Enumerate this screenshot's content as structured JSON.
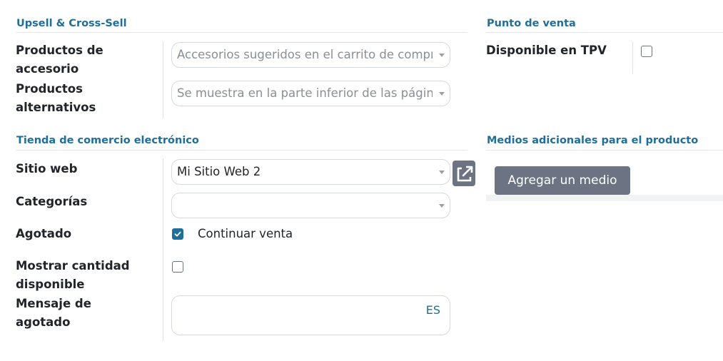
{
  "sections": {
    "upsell": {
      "title": "Upsell & Cross-Sell"
    },
    "pos": {
      "title": "Punto de venta"
    },
    "ecommerce": {
      "title": "Tienda de comercio electrónico"
    },
    "media": {
      "title": "Medios adicionales para el producto"
    }
  },
  "upsell": {
    "accessory": {
      "label_line1": "Productos de",
      "label_line2": "accesorio",
      "placeholder": "Accesorios sugeridos en el carrito de compras"
    },
    "alternative": {
      "label_line1": "Productos",
      "label_line2": "alternativos",
      "placeholder": "Se muestra en la parte inferior de las páginas de producto"
    }
  },
  "pos": {
    "available_label": "Disponible en TPV",
    "available_checked": false
  },
  "ecommerce": {
    "website": {
      "label": "Sitio web",
      "value": "Mi Sitio Web 2"
    },
    "categories": {
      "label": "Categorías",
      "value": ""
    },
    "out_of_stock": {
      "label": "Agotado",
      "option_label": "Continuar venta",
      "checked": true
    },
    "show_qty": {
      "label_line1": "Mostrar cantidad",
      "label_line2": "disponible",
      "checked": false
    },
    "oos_message": {
      "label_line1": "Mensaje de",
      "label_line2": "agotado",
      "lang": "ES",
      "value": ""
    }
  },
  "media": {
    "add_button_label": "Agregar un medio"
  },
  "icons": {
    "external_link": "external-link-icon",
    "caret": "chevron-down-icon",
    "check": "check-icon"
  },
  "colors": {
    "accent": "#1f6f9a",
    "button_bg": "#6c7484",
    "border": "#d6d9dd"
  }
}
